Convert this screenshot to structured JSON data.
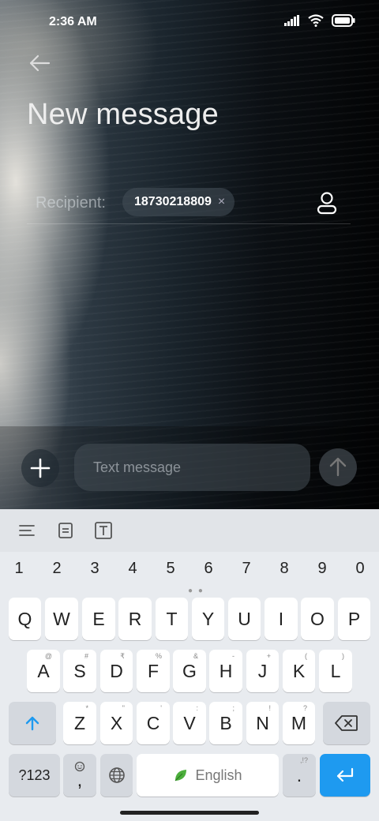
{
  "status_bar": {
    "time": "2:36 AM"
  },
  "header": {
    "title": "New message"
  },
  "recipient": {
    "label": "Recipient:",
    "chip_text": "18730218809",
    "chip_close": "×"
  },
  "compose": {
    "placeholder": "Text message"
  },
  "keyboard": {
    "toolbar_icons": [
      "menu-icon",
      "clipboard-icon",
      "text-box-icon"
    ],
    "numbers": [
      "1",
      "2",
      "3",
      "4",
      "5",
      "6",
      "7",
      "8",
      "9",
      "0"
    ],
    "row1": [
      "Q",
      "W",
      "E",
      "R",
      "T",
      "Y",
      "U",
      "I",
      "O",
      "P"
    ],
    "row2": [
      {
        "key": "A",
        "hint": "@"
      },
      {
        "key": "S",
        "hint": "#"
      },
      {
        "key": "D",
        "hint": "₹"
      },
      {
        "key": "F",
        "hint": "%"
      },
      {
        "key": "G",
        "hint": "&"
      },
      {
        "key": "H",
        "hint": "-"
      },
      {
        "key": "J",
        "hint": "+"
      },
      {
        "key": "K",
        "hint": "("
      },
      {
        "key": "L",
        "hint": ")"
      }
    ],
    "row3": [
      {
        "key": "Z",
        "hint": "*"
      },
      {
        "key": "X",
        "hint": "\""
      },
      {
        "key": "C",
        "hint": "'"
      },
      {
        "key": "V",
        "hint": ":"
      },
      {
        "key": "B",
        "hint": ";"
      },
      {
        "key": "N",
        "hint": "!"
      },
      {
        "key": "M",
        "hint": "?"
      }
    ],
    "symbols_label": "?123",
    "comma_label": ",",
    "space_label": "English",
    "period_label": ".",
    "period_hint": ",!?"
  },
  "colors": {
    "accent": "#1e9af0",
    "keyboard_bg": "#e8ebef"
  }
}
